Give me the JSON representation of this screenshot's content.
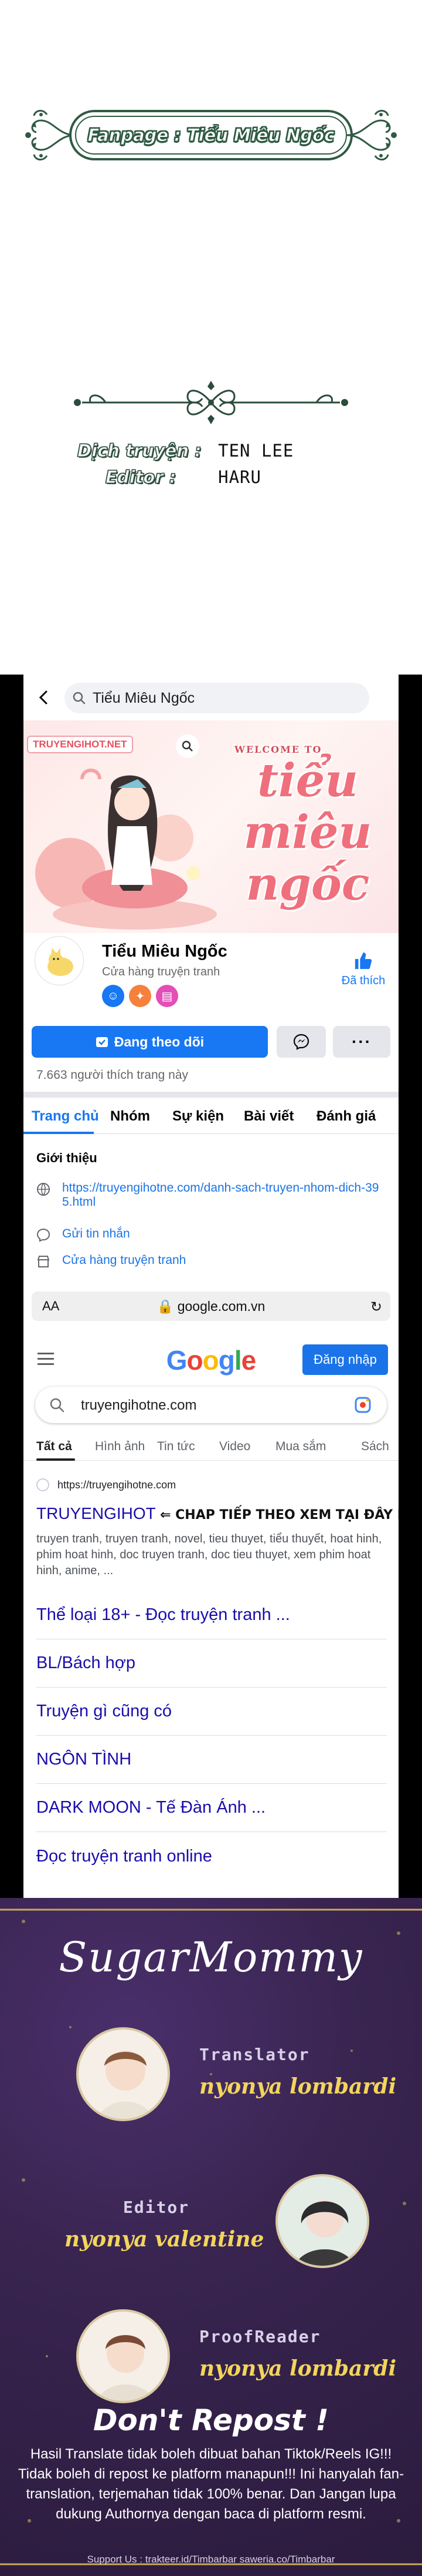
{
  "banner": {
    "text": "Fanpage : Tiểu Miêu Ngốc"
  },
  "credits": {
    "translation_label": "Dịch truyện :",
    "translation_value": "TEN LEE",
    "editor_label": "Editor :",
    "editor_value": "HARU"
  },
  "facebook": {
    "search_text": "Tiểu Miêu Ngốc",
    "cover": {
      "site_badge": "TRUYENGIHOT.NET",
      "welcome": "WELCOME TO",
      "title_lines": [
        "tiểu",
        "miêu",
        "ngốc"
      ]
    },
    "page_name": "Tiểu Miêu Ngốc",
    "page_category": "Cửa hàng truyện tranh",
    "liked_label": "Đã thích",
    "follow_label": "Đang theo dõi",
    "more_label": "···",
    "likes_count": "7.663 người thích trang này",
    "tabs": [
      "Trang chủ",
      "Nhóm",
      "Sự kiện",
      "Bài viết",
      "Đánh giá"
    ],
    "intro_heading": "Giới thiệu",
    "intro_link": "https://truyengihotne.com/danh-sach-truyen-nhom-dich-395.html",
    "intro_message": "Gửi tin nhắn",
    "intro_shop": "Cửa hàng truyện tranh",
    "colors": {
      "primary": "#1877f2"
    }
  },
  "browser": {
    "aa_label": "AA",
    "domain": "google.com.vn"
  },
  "google": {
    "logo": "Google",
    "signin_label": "Đăng nhập",
    "query": "truyengihotne.com",
    "tabs": [
      "Tất cả",
      "Hình ảnh",
      "Tin tức",
      "Video",
      "Mua sắm",
      "Sách"
    ],
    "result": {
      "site": "https://truyengihotne.com",
      "title": "TRUYENGIHOT",
      "annotation": "⇐ CHAP TIẾP THEO XEM TẠI ĐÂY NHA",
      "snippet": "truyen tranh, truyen tranh, novel, tieu thuyet, tiểu thuyết, hoat hinh, phim hoat hinh, doc truyen tranh, doc tieu thuyet, xem phim hoat hinh, anime, ..."
    },
    "sitelinks": [
      "Thể loại 18+ - Đọc truyện tranh ...",
      "BL/Bách hợp",
      "Truyện gì cũng có",
      "NGÔN TÌNH",
      "DARK MOON - Tế Đàn Ánh ...",
      "Đọc truyện tranh online"
    ]
  },
  "poster": {
    "title": "SugarMommy",
    "translator_label": "Translator",
    "translator_name": "nyonya lombardi",
    "editor_label": "Editor",
    "editor_name": "nyonya valentine",
    "proofreader_label": "ProofReader",
    "proofreader_name": "nyonya lombardi",
    "dont_repost": "Don't Repost !",
    "note": "Hasil Translate tidak boleh dibuat bahan Tiktok/Reels IG!!! Tidak boleh di repost ke platform manapun!!! Ini hanyalah fan-translation, terjemahan tidak 100% benar. Dan Jangan lupa dukung Authornya dengan baca di platform resmi.",
    "support_line": "Support Us :   trakteer.id/Timbarbar   saweria.co/Timbarbar"
  }
}
